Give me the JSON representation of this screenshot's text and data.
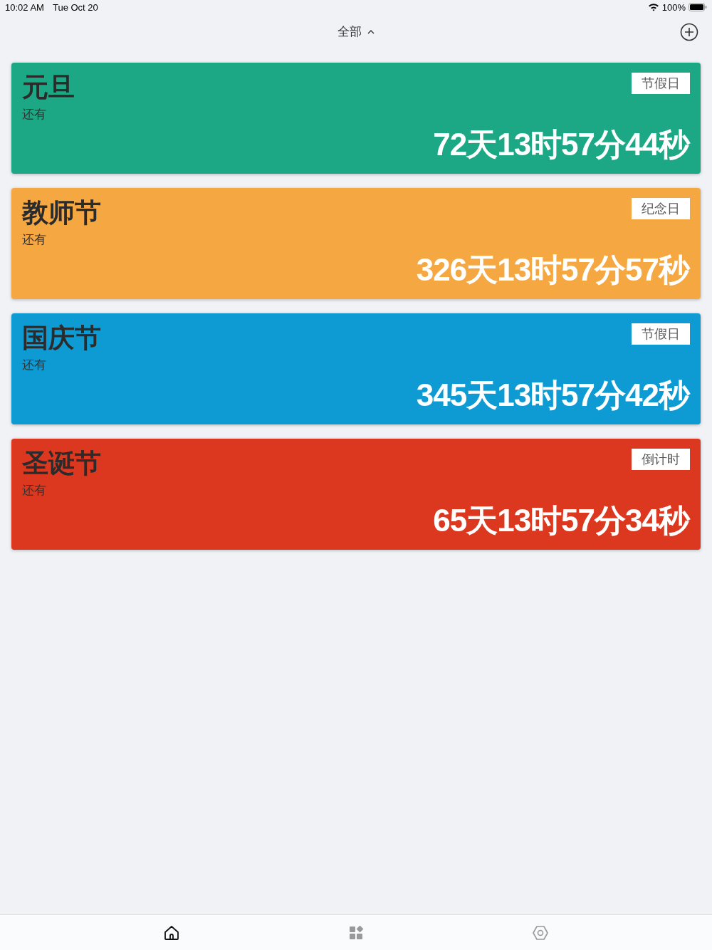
{
  "status_bar": {
    "time": "10:02 AM",
    "date": "Tue Oct 20",
    "battery": "100%"
  },
  "nav": {
    "title": "全部",
    "expanded": true
  },
  "events": [
    {
      "name": "元旦",
      "subtitle": "还有",
      "tag": "节假日",
      "countdown": "72天13时57分44秒",
      "color": "#1ca884"
    },
    {
      "name": "教师节",
      "subtitle": "还有",
      "tag": "纪念日",
      "countdown": "326天13时57分57秒",
      "color": "#f5a742"
    },
    {
      "name": "国庆节",
      "subtitle": "还有",
      "tag": "节假日",
      "countdown": "345天13时57分42秒",
      "color": "#0e9bd3"
    },
    {
      "name": "圣诞节",
      "subtitle": "还有",
      "tag": "倒计时",
      "countdown": "65天13时57分34秒",
      "color": "#dc381f"
    }
  ],
  "tab_bar": [
    {
      "kind": "home",
      "selected": true
    },
    {
      "kind": "apps",
      "selected": false
    },
    {
      "kind": "settings",
      "selected": false
    }
  ]
}
